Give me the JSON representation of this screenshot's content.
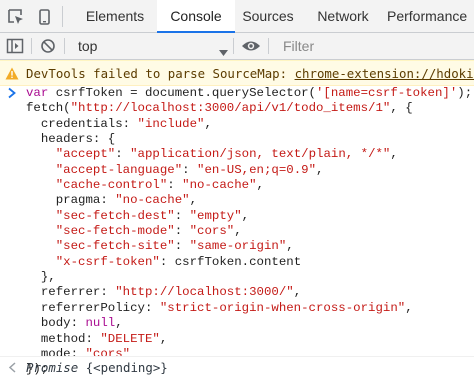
{
  "tabs": {
    "items": [
      {
        "label": "Elements"
      },
      {
        "label": "Console"
      },
      {
        "label": "Sources"
      },
      {
        "label": "Network"
      },
      {
        "label": "Performance"
      }
    ],
    "active": "Console"
  },
  "toolbar": {
    "context_value": "top",
    "filter_placeholder": "Filter"
  },
  "warning": {
    "message": "DevTools failed to parse SourceMap: ",
    "link": "chrome-extension://hdokie"
  },
  "console": {
    "lines": {
      "l1": "csrfToken",
      "l1b": " = document.querySelector(",
      "l1c": "'[name=csrf-token]'",
      "l1d": ");",
      "l2a": "fetch(",
      "l2b": "\"http://localhost:3000/api/v1/todo_items/1\"",
      "l2c": ", {",
      "l3a": "  credentials: ",
      "l3b": "\"include\"",
      "l3c": ",",
      "l4": "  headers: {",
      "l5a": "    ",
      "l5k": "\"accept\"",
      "l5b": ": ",
      "l5v": "\"application/json, text/plain, */*\"",
      "l6k": "\"accept-language\"",
      "l6v": "\"en-US,en;q=0.9\"",
      "l7k": "\"cache-control\"",
      "l7v": "\"no-cache\"",
      "l8a": "    pragma: ",
      "l8v": "\"no-cache\"",
      "l9k": "\"sec-fetch-dest\"",
      "l9v": "\"empty\"",
      "l10k": "\"sec-fetch-mode\"",
      "l10v": "\"cors\"",
      "l11k": "\"sec-fetch-site\"",
      "l11v": "\"same-origin\"",
      "l12k": "\"x-csrf-token\"",
      "l12v": "csrfToken.content",
      "l13": "  },",
      "l14a": "  referrer: ",
      "l14v": "\"http://localhost:3000/\"",
      "l15a": "  referrerPolicy: ",
      "l15v": "\"strict-origin-when-cross-origin\"",
      "l16a": "  body: ",
      "l16v": "null",
      "l17a": "  method: ",
      "l17v": "\"DELETE\"",
      "l18a": "  mode: ",
      "l18v": "\"cors\"",
      "l19": "});",
      "var_kw": "var"
    },
    "result": {
      "label": "Promise",
      "value": "{<pending>}"
    }
  },
  "colors": {
    "accent": "#1a73e8",
    "keyword": "#aa0d91",
    "string": "#c41a16",
    "warning_bg": "#fffbe5"
  },
  "icons": [
    "inspect-element-icon",
    "device-toolbar-icon",
    "sidebar-toggle-icon",
    "clear-console-icon",
    "eye-icon",
    "warning-icon",
    "chevron-right-icon",
    "chevron-left-icon",
    "dropdown-caret-icon"
  ]
}
